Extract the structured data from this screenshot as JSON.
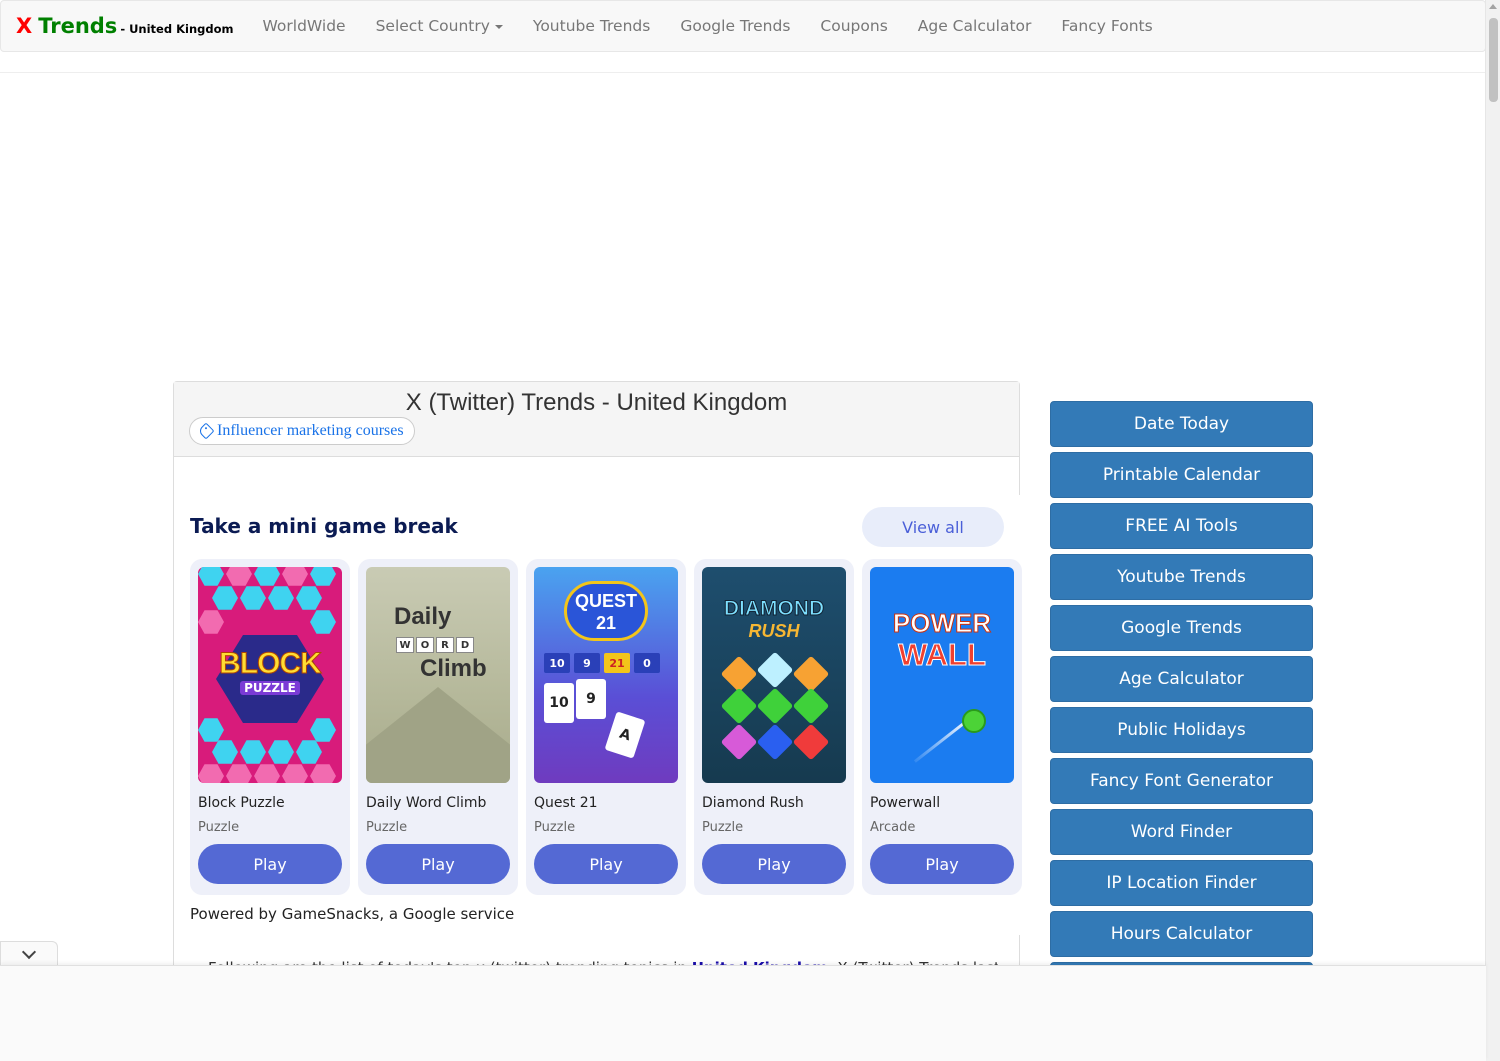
{
  "navbar": {
    "brand_x": "X",
    "brand_trends": "Trends",
    "brand_sub": "- United Kingdom",
    "items": [
      {
        "label": "WorldWide"
      },
      {
        "label": "Select Country"
      },
      {
        "label": "Youtube Trends"
      },
      {
        "label": "Google Trends"
      },
      {
        "label": "Coupons"
      },
      {
        "label": "Age Calculator"
      },
      {
        "label": "Fancy Fonts"
      }
    ]
  },
  "panel": {
    "title": "X (Twitter) Trends - United Kingdom",
    "tag": "Influencer marketing courses"
  },
  "games": {
    "title": "Take a mini game break",
    "view_all": "View all",
    "powered_by": "Powered by GameSnacks, a Google service",
    "items": [
      {
        "name": "Block Puzzle",
        "category": "Puzzle",
        "play": "Play"
      },
      {
        "name": "Daily Word Climb",
        "category": "Puzzle",
        "play": "Play"
      },
      {
        "name": "Quest 21",
        "category": "Puzzle",
        "play": "Play"
      },
      {
        "name": "Diamond Rush",
        "category": "Puzzle",
        "play": "Play"
      },
      {
        "name": "Powerwall",
        "category": "Arcade",
        "play": "Play"
      }
    ],
    "art": {
      "block_word": "BLOCK",
      "block_puzzle": "PUZZLE",
      "word_daily": "Daily",
      "word_tiles": [
        "W",
        "O",
        "R",
        "D"
      ],
      "word_climb": "Climb",
      "quest_title": "QUEST",
      "quest_num": "21",
      "quest_tiles": [
        "10",
        "9",
        "21",
        "0"
      ],
      "quest_cards": [
        "10",
        "9",
        "A"
      ],
      "diamond_title": "DIAMOND",
      "diamond_rush": "RUSH",
      "power_1": "POWER",
      "power_2": "WALL"
    }
  },
  "intro": {
    "prefix": "Following are the list of today's top x (twitter) trending topics in ",
    "link": "United Kingdom",
    "suffix": ". X (Twitter) Trends last"
  },
  "sidebar": {
    "buttons": [
      {
        "label": "Date Today"
      },
      {
        "label": "Printable Calendar"
      },
      {
        "label": "FREE AI Tools"
      },
      {
        "label": "Youtube Trends"
      },
      {
        "label": "Google Trends"
      },
      {
        "label": "Age Calculator"
      },
      {
        "label": "Public Holidays"
      },
      {
        "label": "Fancy Font Generator"
      },
      {
        "label": "Word Finder"
      },
      {
        "label": "IP Location Finder"
      },
      {
        "label": "Hours Calculator"
      }
    ]
  },
  "colors": {
    "brand_x": "#ff0000",
    "brand_trends": "#008000",
    "sidebar_button": "#337ab7",
    "play_button": "#5469d4",
    "games_title": "#0b1b53"
  }
}
